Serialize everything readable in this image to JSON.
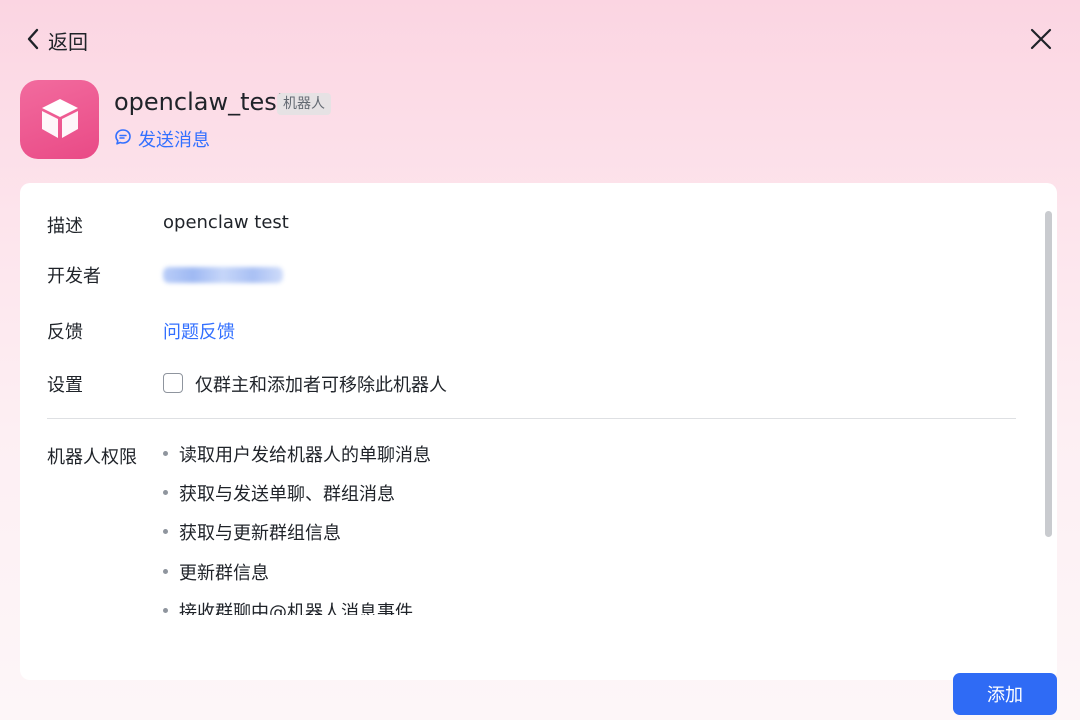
{
  "header": {
    "back_label": "返回",
    "back_icon": "chevron-left-icon",
    "close_icon": "close-icon"
  },
  "bot": {
    "icon": "cube-icon",
    "name": "openclaw_test",
    "badge": "机器人",
    "send_message_label": "发送消息",
    "send_message_icon": "chat-bubble-icon",
    "brand_color": "#e94a86"
  },
  "details": {
    "description_label": "描述",
    "description_value": "openclaw test",
    "developer_label": "开发者",
    "feedback_label": "反馈",
    "feedback_link": "问题反馈",
    "settings_label": "设置",
    "settings_option": "仅群主和添加者可移除此机器人",
    "settings_checked": false
  },
  "permissions": {
    "label": "机器人权限",
    "items": [
      "读取用户发给机器人的单聊消息",
      "获取与发送单聊、群组消息",
      "获取与更新群组信息",
      "更新群信息",
      "接收群聊中@机器人消息事件"
    ]
  },
  "footer": {
    "add_label": "添加",
    "accent_color": "#2f6bf5"
  }
}
